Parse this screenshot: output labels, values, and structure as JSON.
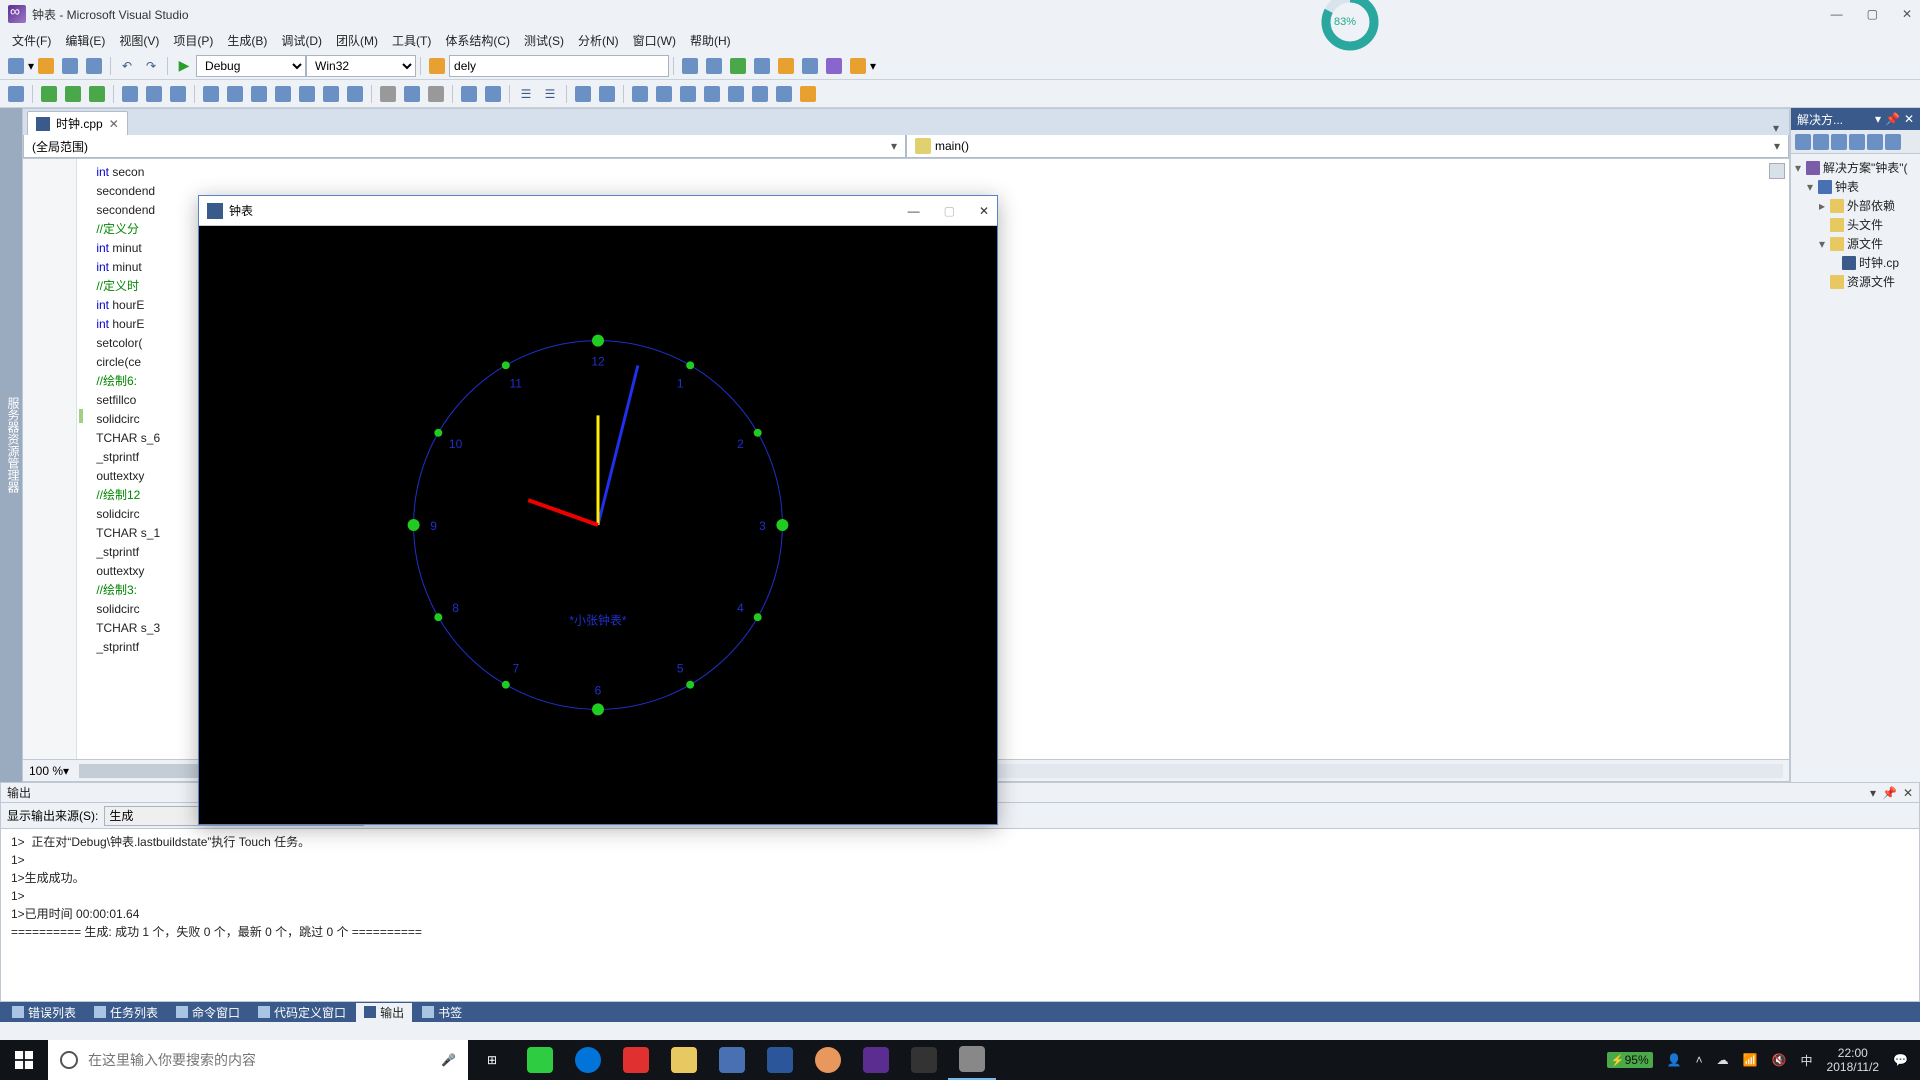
{
  "title": "钟表 - Microsoft Visual Studio",
  "progress_pct": "83%",
  "menu": [
    "文件(F)",
    "编辑(E)",
    "视图(V)",
    "项目(P)",
    "生成(B)",
    "调试(D)",
    "团队(M)",
    "工具(T)",
    "体系结构(C)",
    "测试(S)",
    "分析(N)",
    "窗口(W)",
    "帮助(H)"
  ],
  "toolbar1": {
    "config": "Debug",
    "platform": "Win32",
    "find": "dely"
  },
  "tab": {
    "label": "时钟.cpp"
  },
  "scope": {
    "left": "(全局范围)",
    "right": "main()"
  },
  "code_lines": [
    {
      "k": "kw",
      "pre": "    ",
      "t": "int",
      "rest": " secon"
    },
    {
      "k": "",
      "pre": "    ",
      "t": "",
      "rest": "secondend"
    },
    {
      "k": "",
      "pre": "    ",
      "t": "",
      "rest": "secondend"
    },
    {
      "k": "cm",
      "pre": "    ",
      "t": "//定义分",
      "rest": ""
    },
    {
      "k": "kw",
      "pre": "    ",
      "t": "int",
      "rest": " minut"
    },
    {
      "k": "kw",
      "pre": "    ",
      "t": "int",
      "rest": " minut"
    },
    {
      "k": "cm",
      "pre": "    ",
      "t": "//定义时",
      "rest": ""
    },
    {
      "k": "kw",
      "pre": "    ",
      "t": "int",
      "rest": " hourE"
    },
    {
      "k": "kw",
      "pre": "    ",
      "t": "int",
      "rest": " hourE"
    },
    {
      "k": "",
      "pre": "",
      "t": "",
      "rest": ""
    },
    {
      "k": "",
      "pre": "    ",
      "t": "",
      "rest": "setcolor("
    },
    {
      "k": "",
      "pre": "    ",
      "t": "",
      "rest": "circle(ce"
    },
    {
      "k": "cm",
      "pre": "    ",
      "t": "//绘制6:",
      "rest": ""
    },
    {
      "k": "",
      "pre": "    ",
      "t": "",
      "rest": "setfillco"
    },
    {
      "k": "",
      "pre": "    ",
      "t": "",
      "rest": "solidcirc"
    },
    {
      "k": "",
      "pre": "    ",
      "t": "",
      "rest": "TCHAR s_6"
    },
    {
      "k": "",
      "pre": "    ",
      "t": "",
      "rest": "_stprintf"
    },
    {
      "k": "",
      "pre": "    ",
      "t": "",
      "rest": "outtextxy"
    },
    {
      "k": "cm",
      "pre": "    ",
      "t": "//绘制12",
      "rest": ""
    },
    {
      "k": "",
      "pre": "    ",
      "t": "",
      "rest": "solidcirc"
    },
    {
      "k": "",
      "pre": "    ",
      "t": "",
      "rest": "TCHAR s_1"
    },
    {
      "k": "",
      "pre": "    ",
      "t": "",
      "rest": "_stprintf"
    },
    {
      "k": "",
      "pre": "    ",
      "t": "",
      "rest": "outtextxy"
    },
    {
      "k": "cm",
      "pre": "    ",
      "t": "//绘制3:",
      "rest": ""
    },
    {
      "k": "",
      "pre": "    ",
      "t": "",
      "rest": "solidcirc"
    },
    {
      "k": "",
      "pre": "    ",
      "t": "",
      "rest": "TCHAR s_3"
    },
    {
      "k": "",
      "pre": "    ",
      "t": "",
      "rest": "_stprintf"
    }
  ],
  "zoom": "100 %",
  "solution": {
    "title": "解决方...",
    "root": "解决方案\"钟表\"(",
    "project": "钟表",
    "nodes": [
      "外部依赖",
      "头文件",
      "源文件",
      "时钟.cp",
      "资源文件"
    ]
  },
  "output": {
    "title": "输出",
    "source_label": "显示输出来源(S):",
    "source_value": "生成",
    "lines": [
      "1>  正在对“Debug\\钟表.lastbuildstate”执行 Touch 任务。",
      "1>",
      "1>生成成功。",
      "1>",
      "1>已用时间 00:00:01.64",
      "========== 生成: 成功 1 个，失败 0 个，最新 0 个，跳过 0 个 =========="
    ]
  },
  "bottom_tabs": [
    "错误列表",
    "任务列表",
    "命令窗口",
    "代码定义窗口",
    "输出",
    "书签"
  ],
  "clock_window": {
    "title": "钟表",
    "label": "*小张钟表*",
    "numbers": [
      "12",
      "1",
      "2",
      "3",
      "4",
      "5",
      "6",
      "7",
      "8",
      "9",
      "10",
      "11"
    ]
  },
  "taskbar": {
    "search_placeholder": "在这里输入你要搜索的内容",
    "battery": "95%",
    "ime": "中",
    "time": "22:00",
    "date": "2018/11/2"
  }
}
